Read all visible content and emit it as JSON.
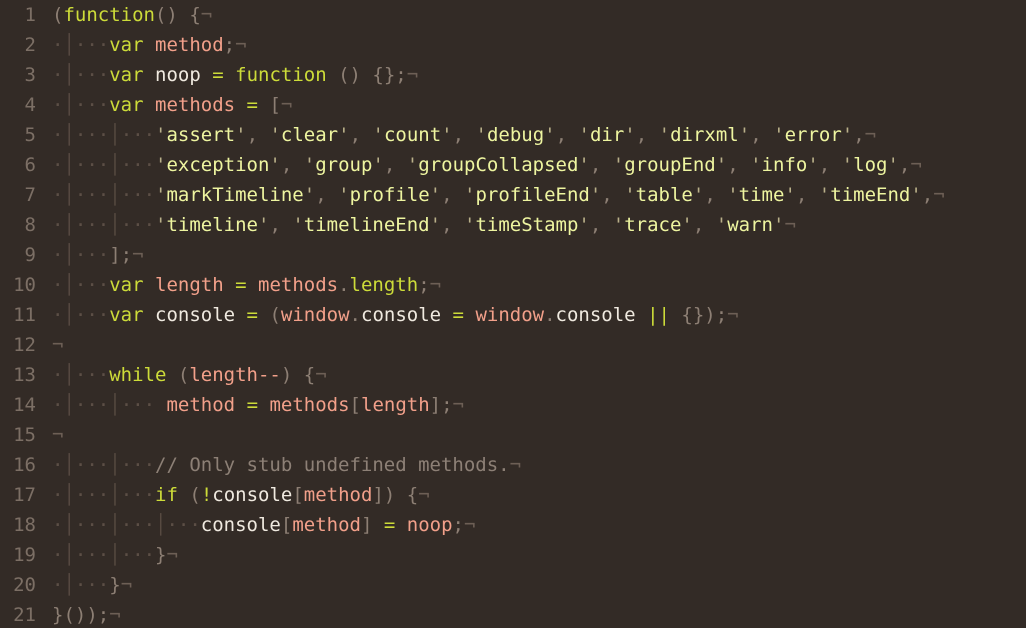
{
  "editor": {
    "background": "#332b26",
    "foreground": "#e8e2d9",
    "gutter_color": "#7c6f65",
    "whitespace_dot": "·",
    "eol_glyph": "¬",
    "indent_guide": "│",
    "language": "javascript",
    "total_lines": 21,
    "first_visible_line": 1,
    "last_visible_line": 21
  },
  "line_numbers": [
    "1",
    "2",
    "3",
    "4",
    "5",
    "6",
    "7",
    "8",
    "9",
    "10",
    "11",
    "12",
    "13",
    "14",
    "15",
    "16",
    "17",
    "18",
    "19",
    "20",
    "21"
  ],
  "source_lines": [
    "(function() {",
    "    var method;",
    "    var noop = function () {};",
    "    var methods = [",
    "        'assert', 'clear', 'count', 'debug', 'dir', 'dirxml', 'error',",
    "        'exception', 'group', 'groupCollapsed', 'groupEnd', 'info', 'log',",
    "        'markTimeline', 'profile', 'profileEnd', 'table', 'time', 'timeEnd',",
    "        'timeline', 'timelineEnd', 'timeStamp', 'trace', 'warn'",
    "    ];",
    "    var length = methods.length;",
    "    var console = (window.console = window.console || {});",
    "",
    "    while (length--) {",
    "         method = methods[length];",
    "",
    "        // Only stub undefined methods.",
    "        if (!console[method]) {",
    "            console[method] = noop;",
    "        }",
    "    }",
    "}());"
  ],
  "tokens": {
    "keywords": [
      "var",
      "function",
      "while",
      "if"
    ],
    "strings": [
      "assert",
      "clear",
      "count",
      "debug",
      "dir",
      "dirxml",
      "error",
      "exception",
      "group",
      "groupCollapsed",
      "groupEnd",
      "info",
      "log",
      "markTimeline",
      "profile",
      "profileEnd",
      "table",
      "time",
      "timeEnd",
      "timeline",
      "timelineEnd",
      "timeStamp",
      "trace",
      "warn"
    ],
    "identifiers": [
      "method",
      "noop",
      "methods",
      "length",
      "console",
      "window"
    ],
    "comment": "// Only stub undefined methods.",
    "operators": [
      "=",
      "||",
      "!",
      "--"
    ]
  },
  "colors": {
    "background": "#332b26",
    "keyword": "#cddc39",
    "string": "#eef5a0",
    "string_quote": "#b9b089",
    "identifier": "#f2a08a",
    "plain_text": "#f0eae0",
    "punctuation": "#8d7f74",
    "comment": "#8d8076",
    "line_number": "#7c6f65",
    "whitespace_dot": "#5c4f46",
    "indent_guide": "#574a41",
    "eol_marker": "#6d5f55"
  }
}
